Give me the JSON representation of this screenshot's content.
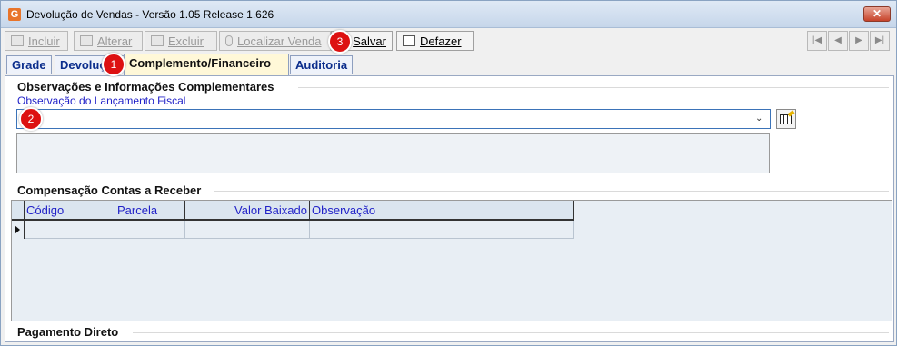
{
  "window": {
    "title": "Devolução de Vendas - Versão 1.05 Release 1.626",
    "close_glyph": "✕"
  },
  "toolbar": {
    "incluir": "Incluir",
    "alterar": "Alterar",
    "excluir": "Excluir",
    "localizar": "Localizar Venda",
    "salvar": "Salvar",
    "defazer": "Defazer",
    "nav": {
      "first": "|◀",
      "prev": "◀",
      "next": "▶",
      "last": "▶|"
    }
  },
  "tabs": [
    {
      "label": "Grade"
    },
    {
      "label": "Devolução"
    },
    {
      "label": "Complemento/Financeiro"
    },
    {
      "label": "Auditoria"
    }
  ],
  "badges": [
    "1",
    "2",
    "3"
  ],
  "observacoes": {
    "group_title": "Observações e Informações Complementares",
    "field_label": "Observação do Lançamento Fiscal",
    "combo_value": "",
    "combo_arrow": "⌄",
    "memo_value": ""
  },
  "compensacao": {
    "group_title": "Compensação Contas a Receber",
    "columns": [
      "Código",
      "Parcela",
      "Valor Baixado",
      "Observação"
    ]
  },
  "pagamento": {
    "group_title": "Pagamento Direto"
  }
}
